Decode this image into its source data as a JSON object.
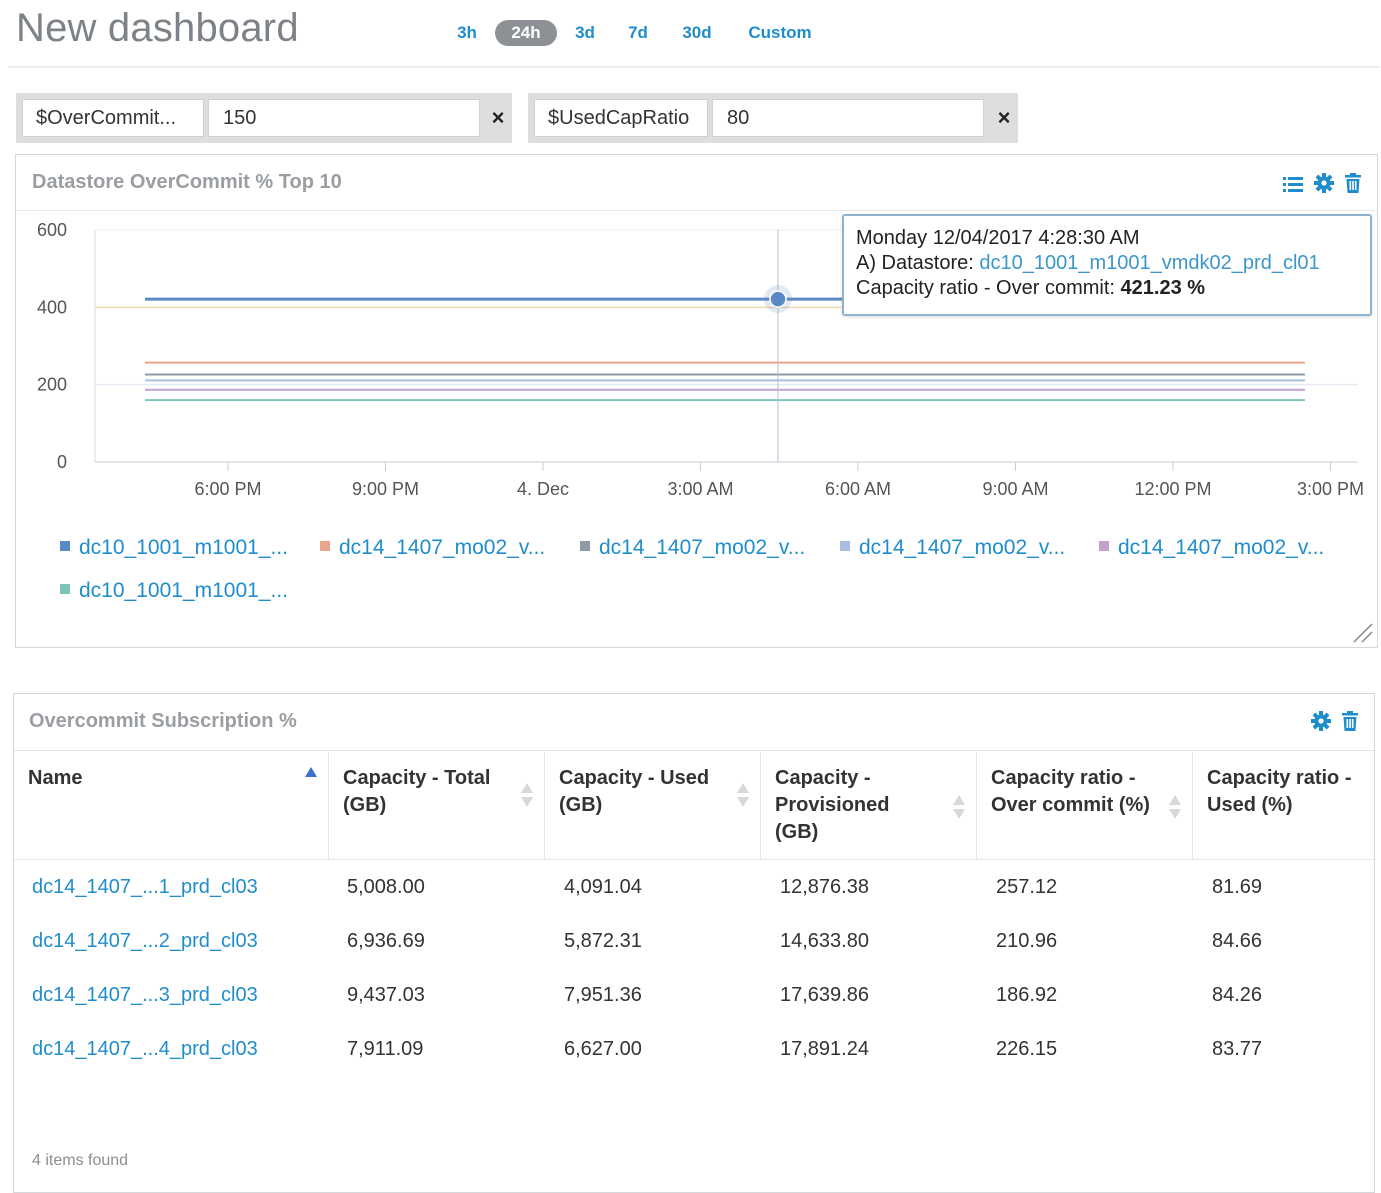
{
  "header": {
    "title": "New dashboard",
    "time_ranges": [
      "3h",
      "24h",
      "3d",
      "7d",
      "30d",
      "Custom"
    ],
    "active_range": "24h"
  },
  "variables": [
    {
      "name": "$OverCommit...",
      "value": "150"
    },
    {
      "name": "$UsedCapRatio",
      "value": "80"
    }
  ],
  "chart_panel": {
    "title": "Datastore OverCommit % Top 10",
    "icons": [
      "list-icon",
      "gear-icon",
      "trash-icon"
    ],
    "tooltip": {
      "time": "Monday 12/04/2017 4:28:30 AM",
      "datastore_label": "A) Datastore:",
      "datastore_value": "dc10_1001_m1001_vmdk02_prd_cl01",
      "metric_label": "Capacity ratio - Over commit:",
      "metric_value": "421.23 %"
    },
    "legend": [
      "dc10_1001_m1001_...",
      "dc14_1407_mo02_v...",
      "dc14_1407_mo02_v...",
      "dc14_1407_mo02_v...",
      "dc14_1407_mo02_v...",
      "dc10_1001_m1001_..."
    ]
  },
  "chart_data": {
    "type": "line",
    "x_ticks": [
      "6:00 PM",
      "9:00 PM",
      "4. Dec",
      "3:00 AM",
      "6:00 AM",
      "9:00 AM",
      "12:00 PM",
      "3:00 PM"
    ],
    "y_ticks": [
      "0",
      "200",
      "400",
      "600"
    ],
    "ylim": [
      0,
      600
    ],
    "x_range_hours": [
      -5.0,
      17.0
    ],
    "hover_x_hours": 4.475,
    "series": [
      {
        "name": "dc10_1001_m1001_...",
        "color": "#5a8ac4",
        "values": [
          421.23,
          421.23
        ]
      },
      {
        "name": "dc14_1407_mo02_v...",
        "color": "#e8a48d",
        "values": [
          257.12,
          257.12
        ]
      },
      {
        "name": "dc14_1407_mo02_v...",
        "color": "#8e9aa8",
        "values": [
          226.15,
          226.15
        ]
      },
      {
        "name": "dc14_1407_mo02_v...",
        "color": "#a9bfe0",
        "values": [
          210.96,
          210.96
        ]
      },
      {
        "name": "dc14_1407_mo02_v...",
        "color": "#c6a0cf",
        "values": [
          186.92,
          186.92
        ]
      },
      {
        "name": "dc10_1001_m1001_...",
        "color": "#7ec4bb",
        "values": [
          160.0,
          160.0
        ]
      }
    ],
    "reference_lines": [
      {
        "value": 400,
        "color": "#f3d7b5"
      },
      {
        "value": 200,
        "color": "#e6ecf4"
      }
    ]
  },
  "table_panel": {
    "title": "Overcommit Subscription %",
    "icons": [
      "gear-icon",
      "trash-icon"
    ],
    "columns": [
      {
        "label": "Name",
        "sort": "asc"
      },
      {
        "label": "Capacity - Total (GB)",
        "sort": "none"
      },
      {
        "label": "Capacity - Used (GB)",
        "sort": "none"
      },
      {
        "label": "Capacity - Provisioned (GB)",
        "sort": "none"
      },
      {
        "label": "Capacity ratio - Over commit (%)",
        "sort": "none"
      },
      {
        "label": "Capacity ratio - Used (%)",
        "sort": "none"
      }
    ],
    "rows": [
      [
        "dc14_1407_...1_prd_cl03",
        "5,008.00",
        "4,091.04",
        "12,876.38",
        "257.12",
        "81.69"
      ],
      [
        "dc14_1407_...2_prd_cl03",
        "6,936.69",
        "5,872.31",
        "14,633.80",
        "210.96",
        "84.66"
      ],
      [
        "dc14_1407_...3_prd_cl03",
        "9,437.03",
        "7,951.36",
        "17,639.86",
        "186.92",
        "84.26"
      ],
      [
        "dc14_1407_...4_prd_cl03",
        "7,911.09",
        "6,627.00",
        "17,891.24",
        "226.15",
        "83.77"
      ]
    ],
    "footer": "4 items found"
  }
}
